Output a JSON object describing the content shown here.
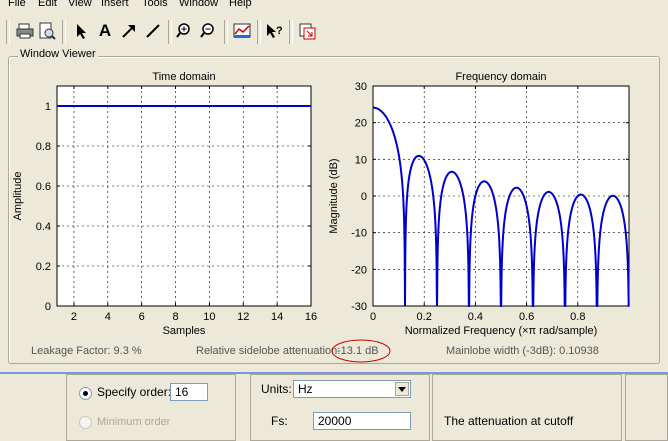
{
  "menu": [
    "File",
    "Edit",
    "View",
    "Insert",
    "Tools",
    "Window",
    "Help"
  ],
  "toolbar": {
    "icons": [
      "print-icon",
      "print-preview-icon",
      "select-arrow-icon",
      "insert-text-icon",
      "insert-arrow-icon",
      "insert-line-icon",
      "zoom-in-icon",
      "zoom-out-icon",
      "edit-plot-icon",
      "whats-this-icon",
      "export-icon"
    ]
  },
  "viewer": {
    "title": "Window Viewer",
    "time_chart": {
      "type": "line",
      "title": "Time domain",
      "xlabel": "Samples",
      "ylabel": "Amplitude",
      "xlim": [
        1,
        16
      ],
      "ylim": [
        0,
        1.1
      ],
      "xticks": [
        "2",
        "4",
        "6",
        "8",
        "10",
        "12",
        "14",
        "16"
      ],
      "yticks": [
        "0",
        "0.2",
        "0.4",
        "0.6",
        "0.8",
        "1"
      ],
      "grid": true,
      "series": [
        {
          "x": [
            1,
            2,
            3,
            4,
            5,
            6,
            7,
            8,
            9,
            10,
            11,
            12,
            13,
            14,
            15,
            16
          ],
          "values": [
            1,
            1,
            1,
            1,
            1,
            1,
            1,
            1,
            1,
            1,
            1,
            1,
            1,
            1,
            1,
            1
          ]
        }
      ]
    },
    "freq_chart": {
      "type": "line",
      "title": "Frequency domain",
      "xlabel": "Normalized Frequency  (×π rad/sample)",
      "ylabel": "Magnitude (dB)",
      "xlim": [
        0,
        1
      ],
      "ylim": [
        -30,
        30
      ],
      "xticks": [
        "0",
        "0.2",
        "0.4",
        "0.6",
        "0.8"
      ],
      "yticks": [
        "-30",
        "-20",
        "-10",
        "0",
        "10",
        "20",
        "30"
      ],
      "grid": true,
      "window_length": 16,
      "peak_db": 24.1
    },
    "status": {
      "leakage": "Leakage Factor: 9.3 %",
      "sidelobe_label": "Relative sidelobe attenuation:",
      "sidelobe_value": "-13.1 dB",
      "mainlobe": "Mainlobe width (-3dB): 0.10938"
    }
  },
  "order_panel": {
    "specify_label": "Specify order:",
    "specify_value": "16",
    "minimum_label": "Minimum order"
  },
  "freq_panel": {
    "units_label": "Units:",
    "units_value": "Hz",
    "fs_label": "Fs:",
    "fs_value": "20000"
  },
  "info_panel": {
    "text": "The attenuation at cutoff"
  },
  "colors": {
    "line": "#0000cc",
    "highlight": "#cc0000"
  }
}
